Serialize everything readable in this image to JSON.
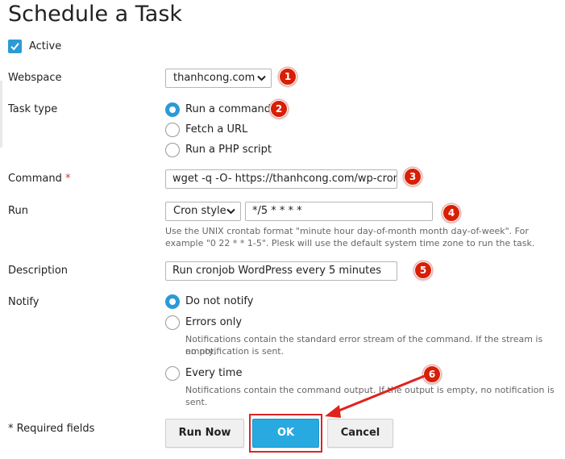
{
  "page": {
    "title": "Schedule a Task"
  },
  "active": {
    "label": "Active",
    "checked": true
  },
  "webspace": {
    "label": "Webspace",
    "value": "thanhcong.com",
    "badge": "1"
  },
  "task_type": {
    "label": "Task type",
    "badge": "2",
    "options": [
      "Run a command",
      "Fetch a URL",
      "Run a PHP script"
    ],
    "selected": "Run a command"
  },
  "command": {
    "label": "Command",
    "required_mark": "*",
    "value": "wget -q -O- https://thanhcong.com/wp-cron.ph",
    "badge": "3"
  },
  "run": {
    "label": "Run",
    "style_value": "Cron style",
    "cron_value": "*/5 * * * *",
    "badge": "4",
    "hint_line1": "Use the UNIX crontab format \"minute hour day-of-month month day-of-week\". For",
    "hint_line2": "example \"0 22 * * 1-5\". Plesk will use the default system time zone to run the task."
  },
  "description": {
    "label": "Description",
    "value": "Run cronjob WordPress every 5 minutes",
    "badge": "5"
  },
  "notify": {
    "label": "Notify",
    "options": [
      "Do not notify",
      "Errors only",
      "Every time"
    ],
    "selected": "Do not notify",
    "errors_hint_line1": "Notifications contain the standard error stream of the command. If the stream is empty,",
    "errors_hint_line2": "no notification is sent.",
    "every_hint": "Notifications contain the command output. If the output is empty, no notification is sent."
  },
  "footer": {
    "required_note": "* Required fields",
    "run_now_label": "Run Now",
    "ok_label": "OK",
    "cancel_label": "Cancel",
    "badge": "6"
  },
  "colors": {
    "accent": "#28aae1",
    "radio_checked": "#2c9ad6",
    "badge": "#d81e05",
    "annotation_red": "#d72727"
  }
}
